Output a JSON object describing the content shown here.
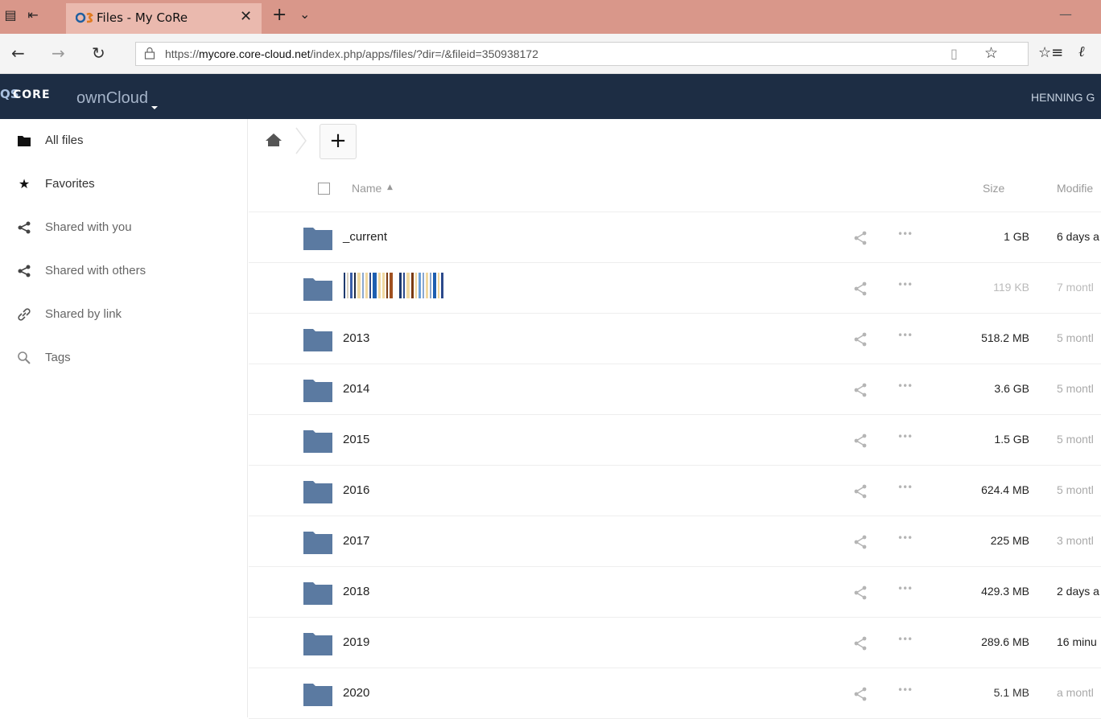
{
  "browser": {
    "tab_title": "Files - My CoRe",
    "tab_favicon_text": "QS",
    "url_prefix": "https://",
    "url_domain": "mycore.core-cloud.net",
    "url_path": "/index.php/apps/files/?dir=/&fileid=350938172"
  },
  "header": {
    "logo_top": "QS",
    "logo_text": "CORE",
    "app_name": "ownCloud",
    "user": "HENNING G"
  },
  "sidebar": {
    "items": [
      {
        "label": "All files",
        "icon": "folder-icon"
      },
      {
        "label": "Favorites",
        "icon": "star-icon"
      },
      {
        "label": "Shared with you",
        "icon": "share-icon"
      },
      {
        "label": "Shared with others",
        "icon": "share-icon"
      },
      {
        "label": "Shared by link",
        "icon": "link-icon"
      },
      {
        "label": "Tags",
        "icon": "search-icon"
      }
    ]
  },
  "toolbar": {
    "add_label": "+"
  },
  "table": {
    "columns": {
      "name": "Name",
      "size": "Size",
      "modified": "Modifie"
    },
    "rows": [
      {
        "name": "_current",
        "size": "1 GB",
        "modified": "6 days a",
        "size_color": "#222222",
        "mod_color": "#222222"
      },
      {
        "name": "",
        "size": "119 KB",
        "modified": "7 montl",
        "size_color": "#bbbbbb",
        "mod_color": "#bbbbbb",
        "redacted": true
      },
      {
        "name": "2013",
        "size": "518.2 MB",
        "modified": "5 montl",
        "size_color": "#222222",
        "mod_color": "#aaaaaa"
      },
      {
        "name": "2014",
        "size": "3.6 GB",
        "modified": "5 montl",
        "size_color": "#222222",
        "mod_color": "#aaaaaa"
      },
      {
        "name": "2015",
        "size": "1.5 GB",
        "modified": "5 montl",
        "size_color": "#222222",
        "mod_color": "#aaaaaa"
      },
      {
        "name": "2016",
        "size": "624.4 MB",
        "modified": "5 montl",
        "size_color": "#222222",
        "mod_color": "#aaaaaa"
      },
      {
        "name": "2017",
        "size": "225 MB",
        "modified": "3 montl",
        "size_color": "#222222",
        "mod_color": "#aaaaaa"
      },
      {
        "name": "2018",
        "size": "429.3 MB",
        "modified": "2 days a",
        "size_color": "#222222",
        "mod_color": "#222222"
      },
      {
        "name": "2019",
        "size": "289.6 MB",
        "modified": "16 minu",
        "size_color": "#222222",
        "mod_color": "#222222"
      },
      {
        "name": "2020",
        "size": "5.1 MB",
        "modified": "a montl",
        "size_color": "#333333",
        "mod_color": "#aaaaaa"
      }
    ]
  },
  "colors": {
    "header_bg": "#1d2d44",
    "folder": "#5b7aa1",
    "tabbar": "#d9978a"
  }
}
